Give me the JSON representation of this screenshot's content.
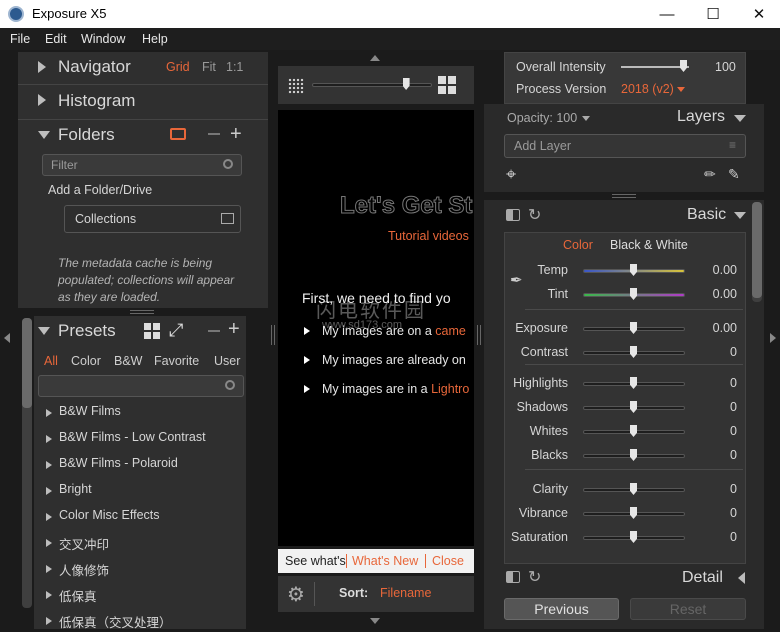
{
  "window": {
    "title": "Exposure X5"
  },
  "menu": [
    "File",
    "Edit",
    "Window",
    "Help"
  ],
  "navigator": {
    "title": "Navigator",
    "grid": "Grid",
    "fit": "Fit",
    "one": "1:1"
  },
  "histogram": {
    "title": "Histogram"
  },
  "folders": {
    "title": "Folders",
    "filter_placeholder": "Filter",
    "add_folder": "Add a Folder/Drive",
    "collections": "Collections",
    "cache_msg": "The metadata cache is being populated; collections will appear as they are loaded."
  },
  "presets": {
    "title": "Presets",
    "tabs": [
      "All",
      "Color",
      "B&W",
      "Favorite",
      "User"
    ],
    "items": [
      "B&W Films",
      "B&W Films - Low Contrast",
      "B&W Films - Polaroid",
      "Bright",
      "Color Misc Effects",
      "交叉冲印",
      "人像修饰",
      "低保真",
      "低保真（交叉处理）"
    ]
  },
  "center": {
    "headline": "Let's Get St",
    "tutorial": "Tutorial videos",
    "first_line": "First, we need to find yo",
    "options": [
      {
        "text": "My images are on a ",
        "link": "came"
      },
      {
        "text": "My images are already on",
        "link": ""
      },
      {
        "text": "My images are in a ",
        "link": "Lightro"
      }
    ],
    "watermark": "闪电软件园",
    "watermark_url": "www.sd173.com",
    "banner": {
      "prefix": "See what's",
      "link": "What's New",
      "close": "Close"
    },
    "sort_label": "Sort:",
    "sort_value": "Filename",
    "zoom_level": 0.78
  },
  "right": {
    "overall_intensity_label": "Overall Intensity",
    "overall_intensity_value": "100",
    "process_version_label": "Process Version",
    "process_version_value": "2018 (v2)",
    "opacity": "Opacity: 100",
    "layers": "Layers",
    "add_layer": "Add Layer",
    "basic": {
      "title": "Basic",
      "tab_color": "Color",
      "tab_bw": "Black & White",
      "rows": [
        {
          "label": "Temp",
          "value": "0.00"
        },
        {
          "label": "Tint",
          "value": "0.00"
        },
        {
          "label": "Exposure",
          "value": "0.00"
        },
        {
          "label": "Contrast",
          "value": "0"
        },
        {
          "label": "Highlights",
          "value": "0"
        },
        {
          "label": "Shadows",
          "value": "0"
        },
        {
          "label": "Whites",
          "value": "0"
        },
        {
          "label": "Blacks",
          "value": "0"
        },
        {
          "label": "Clarity",
          "value": "0"
        },
        {
          "label": "Vibrance",
          "value": "0"
        },
        {
          "label": "Saturation",
          "value": "0"
        }
      ]
    },
    "detail": "Detail",
    "previous": "Previous",
    "reset": "Reset"
  }
}
